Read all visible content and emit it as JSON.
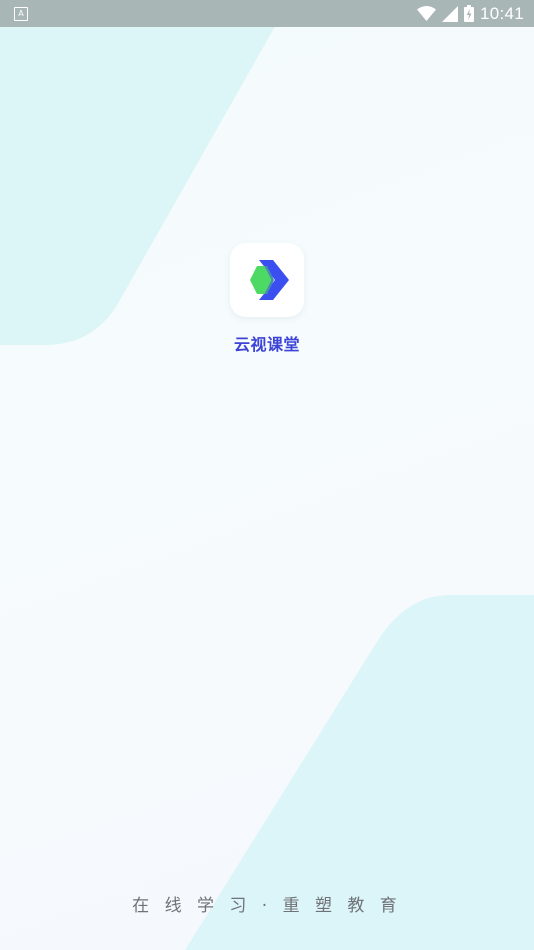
{
  "status_bar": {
    "notification_icon": "A",
    "time": "10:41",
    "icons": [
      "wifi-icon",
      "cell-signal-icon",
      "battery-charging-icon"
    ]
  },
  "splash": {
    "app_name": "云视课堂",
    "slogan": "在 线 学 习 · 重 塑 教 育",
    "logo_colors": {
      "green": "#4cd964",
      "blue": "#3b4ef0"
    }
  },
  "colors": {
    "status_bar_bg": "#a9b6b6",
    "accent_teal": "#dbf5f7",
    "app_name_color": "#3c43d6",
    "slogan_color": "#6f7278"
  }
}
